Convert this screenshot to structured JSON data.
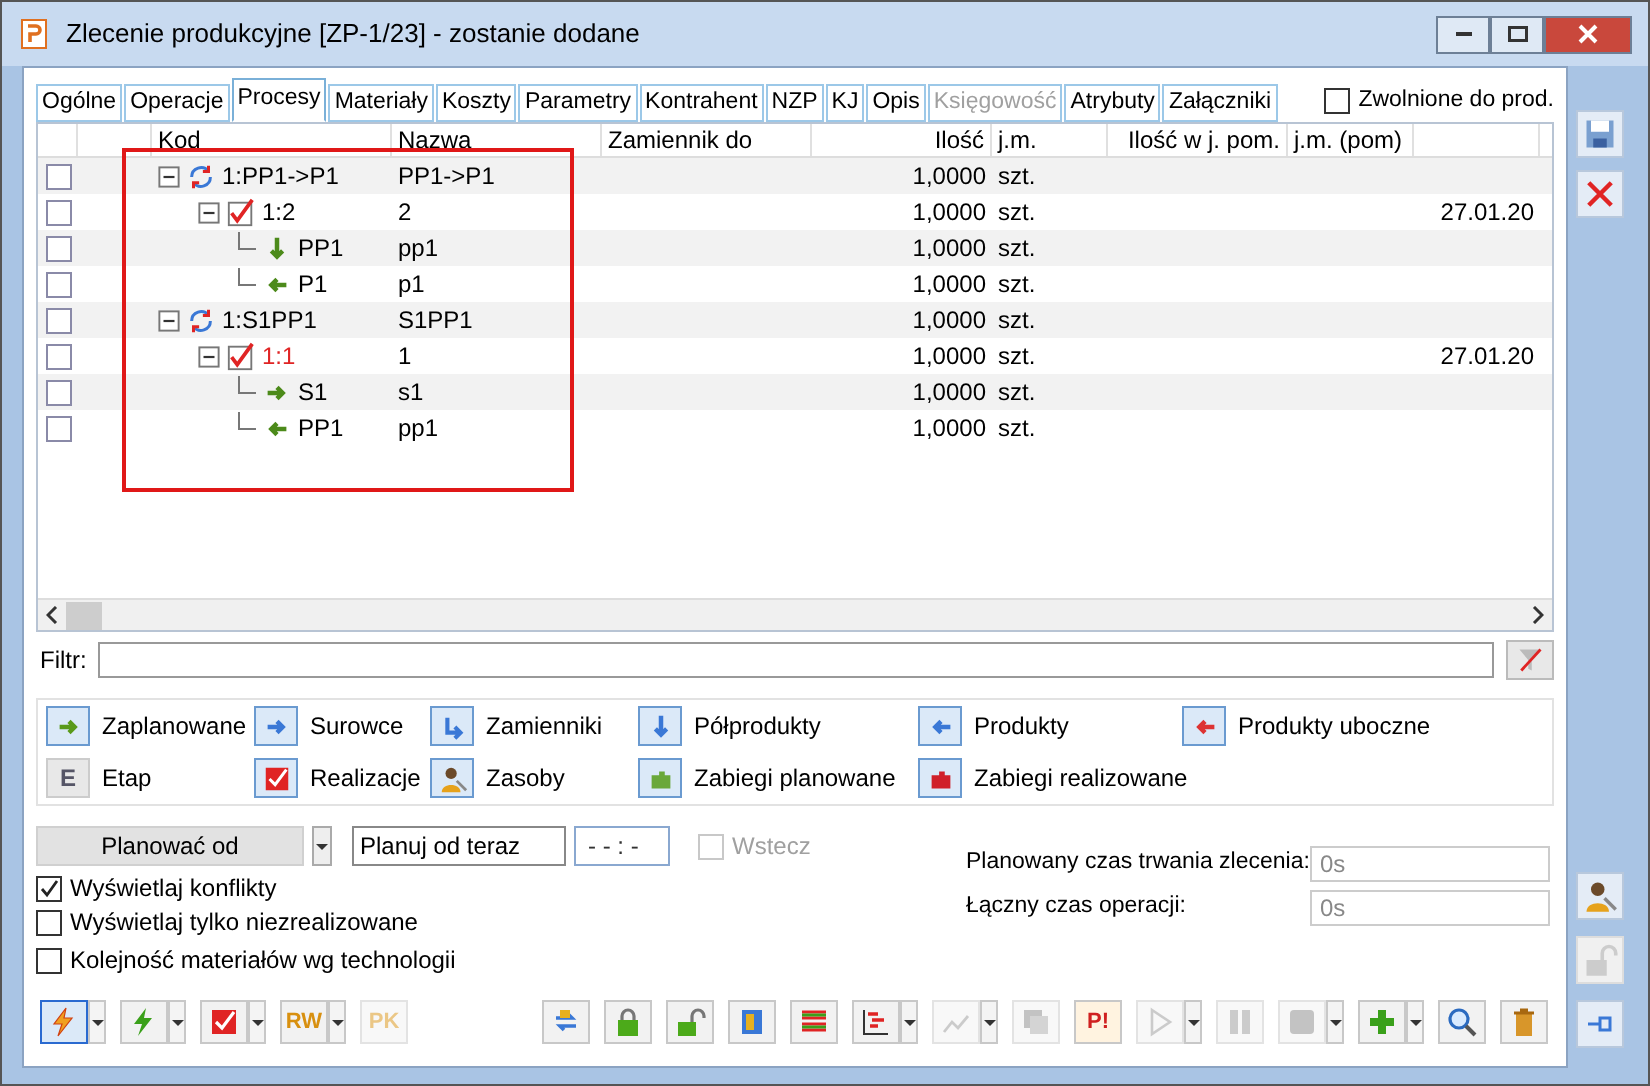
{
  "window": {
    "title": "Zlecenie produkcyjne  [ZP-1/23] - zostanie dodane"
  },
  "tabs": [
    {
      "label": "Ogólne",
      "selected": false,
      "disabled": false
    },
    {
      "label": "Operacje",
      "selected": false,
      "disabled": false
    },
    {
      "label": "Procesy",
      "selected": true,
      "disabled": false
    },
    {
      "label": "Materiały",
      "selected": false,
      "disabled": false
    },
    {
      "label": "Koszty",
      "selected": false,
      "disabled": false
    },
    {
      "label": "Parametry",
      "selected": false,
      "disabled": false
    },
    {
      "label": "Kontrahent",
      "selected": false,
      "disabled": false
    },
    {
      "label": "NZP",
      "selected": false,
      "disabled": false
    },
    {
      "label": "KJ",
      "selected": false,
      "disabled": false
    },
    {
      "label": "Opis",
      "selected": false,
      "disabled": false
    },
    {
      "label": "Księgowość",
      "selected": false,
      "disabled": true
    },
    {
      "label": "Atrybuty",
      "selected": false,
      "disabled": false
    },
    {
      "label": "Załączniki",
      "selected": false,
      "disabled": false
    }
  ],
  "released": {
    "label": "Zwolnione do prod.",
    "checked": false
  },
  "table": {
    "columns": [
      "Kod",
      "Nazwa",
      "Zamiennik do",
      "Ilość",
      "j.m.",
      "Ilość w j. pom.",
      "j.m. (pom)"
    ],
    "rows": [
      {
        "kind": "process",
        "checked": false,
        "code": "1:PP1->P1",
        "name": "PP1->P1",
        "qty": "1,0000",
        "unit": "szt.",
        "expanded": true,
        "warning": false,
        "children": [
          {
            "kind": "stage",
            "checked": false,
            "code": "1:2",
            "name": "2",
            "qty": "1,0000",
            "unit": "szt.",
            "date": "27.01.20",
            "expanded": true,
            "warning": false,
            "children": [
              {
                "kind": "semi",
                "checked": false,
                "code": "PP1",
                "name": "pp1",
                "qty": "1,0000",
                "unit": "szt.",
                "warning": false
              },
              {
                "kind": "product",
                "checked": false,
                "code": "P1",
                "name": "p1",
                "qty": "1,0000",
                "unit": "szt.",
                "warning": false
              }
            ]
          }
        ]
      },
      {
        "kind": "process",
        "checked": false,
        "code": "1:S1PP1",
        "name": "S1PP1",
        "qty": "1,0000",
        "unit": "szt.",
        "expanded": true,
        "warning": false,
        "children": [
          {
            "kind": "stage",
            "checked": false,
            "code": "1:1",
            "name": "1",
            "qty": "1,0000",
            "unit": "szt.",
            "date": "27.01.20",
            "expanded": true,
            "warning": true,
            "children": [
              {
                "kind": "raw",
                "checked": false,
                "code": "S1",
                "name": "s1",
                "qty": "1,0000",
                "unit": "szt.",
                "warning": false
              },
              {
                "kind": "product",
                "checked": false,
                "code": "PP1",
                "name": "pp1",
                "qty": "1,0000",
                "unit": "szt.",
                "warning": false
              }
            ]
          }
        ]
      }
    ]
  },
  "filter": {
    "label": "Filtr:"
  },
  "legend": [
    {
      "kind": "planned",
      "label": "Zaplanowane"
    },
    {
      "kind": "raw",
      "label": "Surowce"
    },
    {
      "kind": "substitute",
      "label": "Zamienniki"
    },
    {
      "kind": "semi",
      "label": "Półprodukty"
    },
    {
      "kind": "product",
      "label": "Produkty"
    },
    {
      "kind": "byproduct",
      "label": "Produkty uboczne"
    },
    {
      "kind": "letter",
      "glyph": "E",
      "label": "Etap"
    },
    {
      "kind": "realization",
      "label": "Realizacje"
    },
    {
      "kind": "resources",
      "label": "Zasoby"
    },
    {
      "kind": "planned-ops",
      "label": "Zabiegi planowane"
    },
    {
      "kind": "realized-ops",
      "label": "Zabiegi realizowane"
    }
  ],
  "planning": {
    "button": "Planować od",
    "mode": "Planuj od teraz",
    "time": "- - : -",
    "backward": {
      "label": "Wstecz",
      "checked": false,
      "disabled": true
    }
  },
  "options": [
    {
      "label": "Wyświetlaj konflikty",
      "checked": true
    },
    {
      "label": "Wyświetlaj tylko niezrealizowane",
      "checked": false
    },
    {
      "label": "Kolejność materiałów wg technologii",
      "checked": false
    }
  ],
  "durations": [
    {
      "label": "Planowany czas trwania zlecenia:",
      "value": "0s"
    },
    {
      "label": "Łączny czas operacji:",
      "value": "0s"
    }
  ],
  "toolbar_left": [
    {
      "kind": "bolt",
      "dropdown": true,
      "disabled": false,
      "selected": true
    },
    {
      "kind": "bolt-green",
      "dropdown": true,
      "disabled": false,
      "selected": false
    },
    {
      "kind": "check",
      "dropdown": true,
      "disabled": false,
      "selected": false
    },
    {
      "kind": "letters",
      "glyph": "RW",
      "dropdown": true,
      "disabled": false,
      "selected": false
    },
    {
      "kind": "letters",
      "glyph": "PK",
      "dropdown": false,
      "disabled": true,
      "selected": false
    }
  ],
  "toolbar_mid": [
    {
      "kind": "swap",
      "dropdown": false,
      "disabled": false
    },
    {
      "kind": "lock",
      "dropdown": false,
      "disabled": false
    },
    {
      "kind": "unlock",
      "dropdown": false,
      "disabled": false
    },
    {
      "kind": "door",
      "dropdown": false,
      "disabled": false
    },
    {
      "kind": "lines",
      "dropdown": false,
      "disabled": false
    },
    {
      "kind": "gantt",
      "dropdown": true,
      "disabled": false
    },
    {
      "kind": "chart",
      "dropdown": true,
      "disabled": true
    },
    {
      "kind": "copy",
      "dropdown": false,
      "disabled": true
    }
  ],
  "toolbar_right": [
    {
      "kind": "letters",
      "glyph": "P!",
      "dropdown": false,
      "disabled": false
    },
    {
      "kind": "play",
      "dropdown": true,
      "disabled": true
    },
    {
      "kind": "pause",
      "dropdown": false,
      "disabled": true
    },
    {
      "kind": "stop",
      "dropdown": true,
      "disabled": true
    },
    {
      "kind": "add",
      "dropdown": true,
      "disabled": false
    },
    {
      "kind": "search",
      "dropdown": false,
      "disabled": false
    },
    {
      "kind": "delete",
      "dropdown": false,
      "disabled": false
    }
  ]
}
